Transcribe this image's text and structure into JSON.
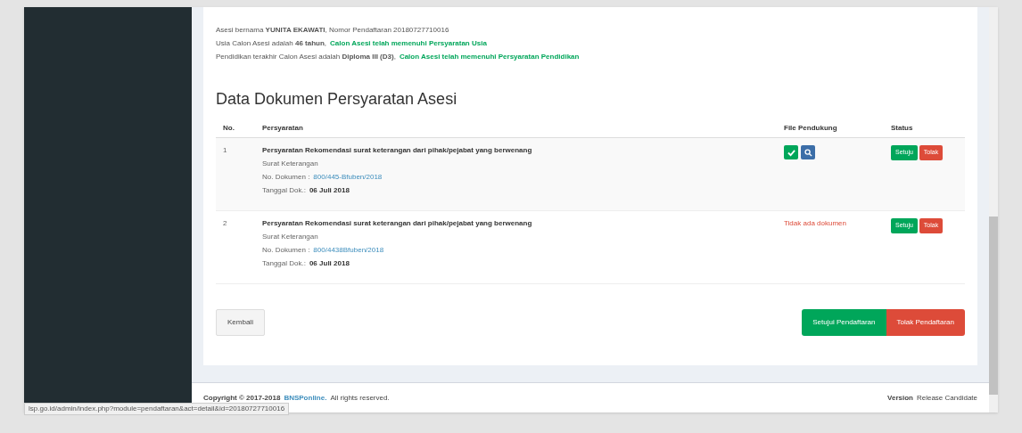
{
  "info_lines": [
    {
      "text": "Asesi bernama **YUNITA EKAWATI**, Nomor Pendaftaran 20180727710016"
    },
    {
      "text": "Usia Calon Asesi adalah **46 tahun**,",
      "note": "Calon Asesi telah memenuhi Persyaratan Usia"
    },
    {
      "text": "Pendidikan terakhir Calon Asesi adalah **Diploma III (D3)**,",
      "note": "Calon Asesi telah memenuhi Persyaratan Pendidikan"
    }
  ],
  "section_title": "Data Dokumen Persyaratan Asesi",
  "table": {
    "columns": [
      "No.",
      "Persyaratan",
      "File Pendukung",
      "Status"
    ],
    "rows": [
      {
        "no": "1",
        "title": "Persyaratan Rekomendasi surat keterangan dari pihak/pejabat yang berwenang",
        "type": "Surat Keterangan",
        "doc_label": "No. Dokumen :",
        "doc_number": "800/445-Bfuben/2018",
        "date_label": "Tanggal Dok.:",
        "date": "06 Juli 2018",
        "has_file": true,
        "approve": "Setuju",
        "reject": "Tolak"
      },
      {
        "no": "2",
        "title": "Persyaratan Rekomendasi surat keterangan dari pihak/pejabat yang berwenang",
        "type": "Surat Keterangan",
        "doc_label": "No. Dokumen :",
        "doc_number": "800/4438Bfuben/2018",
        "date_label": "Tanggal Dok.:",
        "date": "06 Juli 2018",
        "has_file": false,
        "no_file_text": "Tidak ada dokumen",
        "approve": "Setuju",
        "reject": "Tolak"
      }
    ]
  },
  "buttons": {
    "back": "Kembali",
    "approve": "Setujui Pendaftaran",
    "reject": "Tolak Pendaftaran"
  },
  "footer": {
    "copyright": "Copyright © 2017-2018",
    "link": "BNSPonline.",
    "rights": "All rights reserved.",
    "version_label": "Version",
    "version": "Release Candidate"
  },
  "status_url": "lsp.go.id/admin/index.php?module=pendaftaran&act=detail&id=20180727710016"
}
